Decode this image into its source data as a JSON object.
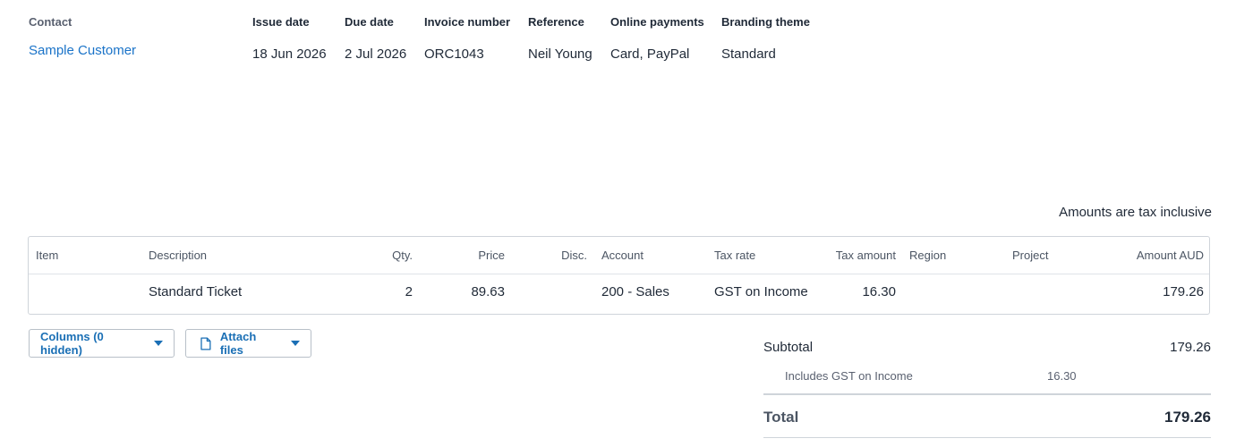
{
  "header": {
    "contact_label": "Contact",
    "contact_name": "Sample Customer",
    "issue_date_label": "Issue date",
    "issue_date": "18 Jun 2026",
    "due_date_label": "Due date",
    "due_date": "2 Jul 2026",
    "invoice_number_label": "Invoice number",
    "invoice_number": "ORC1043",
    "reference_label": "Reference",
    "reference": "Neil Young",
    "online_payments_label": "Online payments",
    "online_payments": "Card, PayPal",
    "branding_theme_label": "Branding theme",
    "branding_theme": "Standard"
  },
  "tax_note": "Amounts are tax inclusive",
  "table": {
    "columns": {
      "item": "Item",
      "description": "Description",
      "qty": "Qty.",
      "price": "Price",
      "disc": "Disc.",
      "account": "Account",
      "tax_rate": "Tax rate",
      "tax_amount": "Tax amount",
      "region": "Region",
      "project": "Project",
      "amount": "Amount AUD"
    },
    "rows": [
      {
        "item": "",
        "description": "Standard Ticket",
        "qty": "2",
        "price": "89.63",
        "disc": "",
        "account": "200 - Sales",
        "tax_rate": "GST on Income",
        "tax_amount": "16.30",
        "region": "",
        "project": "",
        "amount": "179.26"
      }
    ]
  },
  "buttons": {
    "columns_label": "Columns (0 hidden)",
    "attach_label": "Attach files"
  },
  "summary": {
    "subtotal_label": "Subtotal",
    "subtotal": "179.26",
    "gst_label": "Includes GST on Income",
    "gst": "16.30",
    "total_label": "Total",
    "total": "179.26"
  },
  "colors": {
    "link": "#1a73c8",
    "button_text": "#1a6fb5",
    "border": "#cfd4da"
  },
  "icons": {
    "attach": "file-icon",
    "dropdown": "caret-down-icon"
  }
}
